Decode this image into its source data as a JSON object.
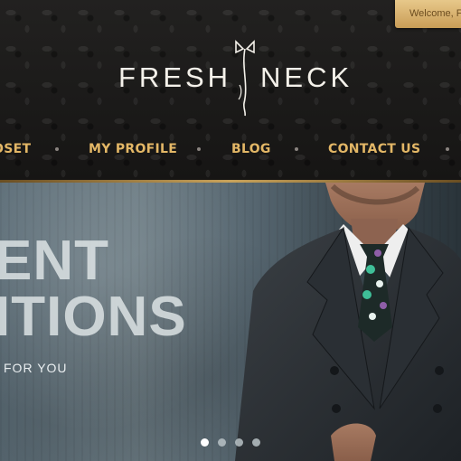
{
  "header": {
    "welcome_text": "Welcome, F",
    "logo": {
      "left_word": "FRESH",
      "right_word": "NECK",
      "tie_icon": "bowtie-tie-icon"
    },
    "nav": [
      {
        "label": "OSET"
      },
      {
        "label": "MY PROFILE"
      },
      {
        "label": "BLOG"
      },
      {
        "label": "CONTACT US"
      }
    ]
  },
  "hero": {
    "line1": "ENT",
    "line2": "ITIONS",
    "subtitle": "FOR YOU",
    "pager_count": 4,
    "pager_active": 1
  },
  "colors": {
    "nav_gold": "#e3b766",
    "header_bg": "#1b1a19",
    "welcome_tab": "#d9b472",
    "hero_wall": "#5c6d77"
  }
}
